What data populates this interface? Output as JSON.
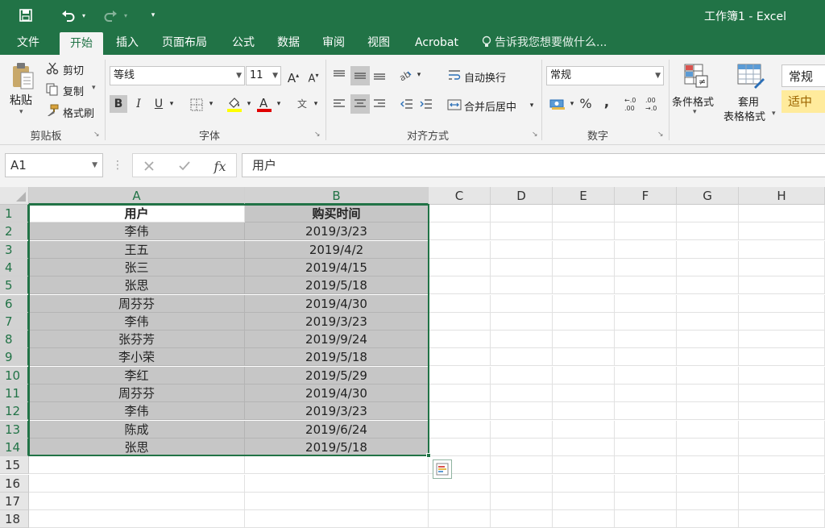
{
  "title_bar": {
    "title": "工作簿1 - Excel"
  },
  "tabs": [
    "文件",
    "开始",
    "插入",
    "页面布局",
    "公式",
    "数据",
    "审阅",
    "视图",
    "Acrobat"
  ],
  "tell_me": "告诉我您想要做什么...",
  "clipboard": {
    "paste": "粘贴",
    "cut": "剪切",
    "copy": "复制",
    "format_painter": "格式刷",
    "group": "剪贴板"
  },
  "font": {
    "name": "等线",
    "size": "11",
    "bold": "B",
    "italic": "I",
    "underline": "U",
    "group": "字体"
  },
  "alignment": {
    "wrap": "自动换行",
    "merge": "合并后居中",
    "group": "对齐方式"
  },
  "number": {
    "format": "常规",
    "percent": "%",
    "comma": ",",
    "group": "数字"
  },
  "styles": {
    "conditional": "条件格式",
    "table_line1": "套用",
    "table_line2": "表格格式",
    "normal": "常规",
    "neutral": "适中"
  },
  "formula_bar": {
    "name_box": "A1",
    "content": "用户"
  },
  "columns": [
    "A",
    "B",
    "C",
    "D",
    "E",
    "F",
    "G",
    "H"
  ],
  "rows": [
    "1",
    "2",
    "3",
    "4",
    "5",
    "6",
    "7",
    "8",
    "9",
    "10",
    "11",
    "12",
    "13",
    "14",
    "15",
    "16",
    "17",
    "18"
  ],
  "table": {
    "headers": [
      "用户",
      "购买时间"
    ],
    "data": [
      [
        "李伟",
        "2019/3/23"
      ],
      [
        "王五",
        "2019/4/2"
      ],
      [
        "张三",
        "2019/4/15"
      ],
      [
        "张思",
        "2019/5/18"
      ],
      [
        "周芬芬",
        "2019/4/30"
      ],
      [
        "李伟",
        "2019/3/23"
      ],
      [
        "张芬芳",
        "2019/9/24"
      ],
      [
        "李小荣",
        "2019/5/18"
      ],
      [
        "李红",
        "2019/5/29"
      ],
      [
        "周芬芬",
        "2019/4/30"
      ],
      [
        "李伟",
        "2019/3/23"
      ],
      [
        "陈成",
        "2019/6/24"
      ],
      [
        "张思",
        "2019/5/18"
      ]
    ]
  },
  "colors": {
    "accent": "#217346",
    "selection": "#c6c6c6",
    "neutral_style_bg": "#ffeb9c",
    "neutral_style_text": "#9c6500"
  }
}
